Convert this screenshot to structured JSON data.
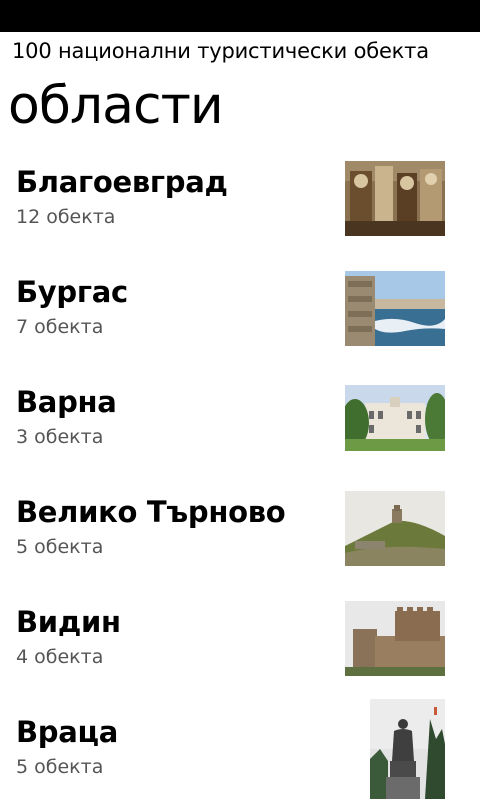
{
  "app": {
    "title": "100 национални туристически обекта"
  },
  "page": {
    "title": "области"
  },
  "regions": [
    {
      "name": "Благоевград",
      "count": "12 обекта",
      "thumbnail": "fresco-photo"
    },
    {
      "name": "Бургас",
      "count": "7 обекта",
      "thumbnail": "sea-coast-photo"
    },
    {
      "name": "Варна",
      "count": "3 обекта",
      "thumbnail": "museum-building-photo"
    },
    {
      "name": "Велико Търново",
      "count": "5 обекта",
      "thumbnail": "hill-fortress-photo"
    },
    {
      "name": "Видин",
      "count": "4 обекта",
      "thumbnail": "stone-castle-photo"
    },
    {
      "name": "Враца",
      "count": "5 обекта",
      "thumbnail": "monument-statue-photo"
    }
  ]
}
